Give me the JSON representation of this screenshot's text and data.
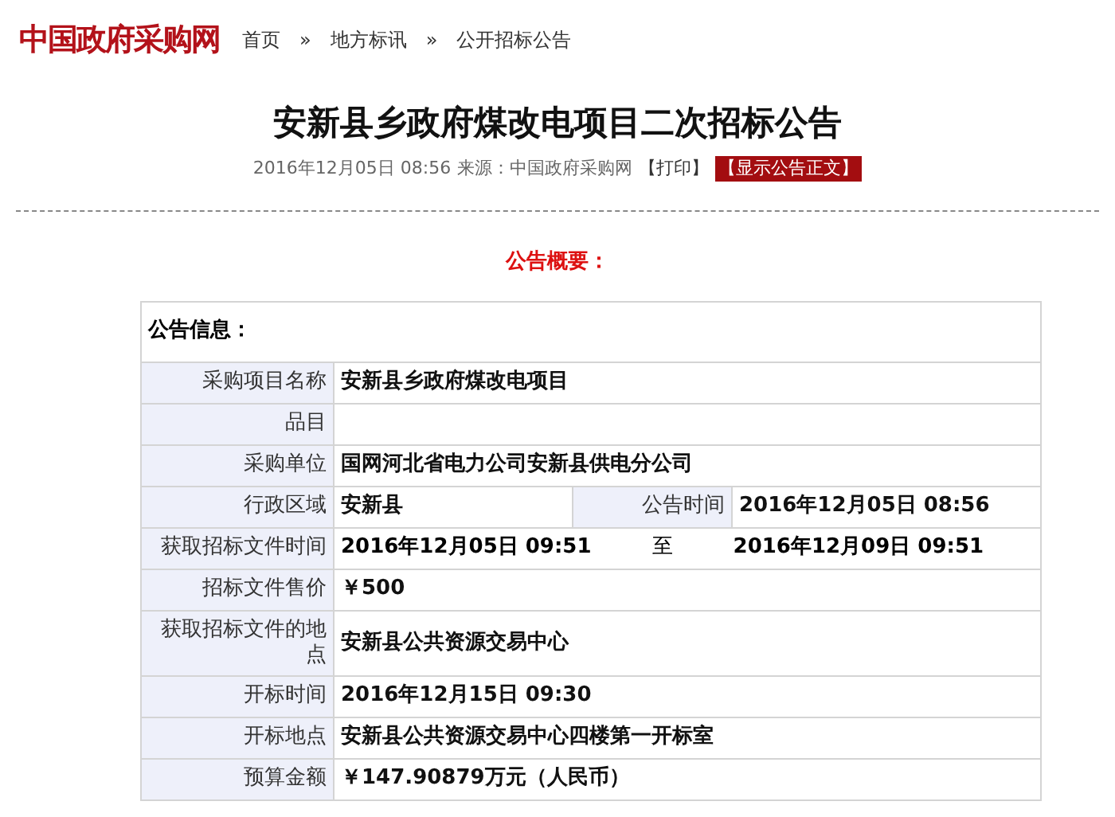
{
  "header": {
    "logo": "中国政府采购网",
    "breadcrumb": [
      "首页",
      "地方标讯",
      "公开招标公告"
    ],
    "separator": "»"
  },
  "article": {
    "title": "安新县乡政府煤改电项目二次招标公告",
    "date": "2016年12月05日 08:56",
    "source": "来源：中国政府采购网",
    "print_link": "【打印】",
    "show_text_link": "【显示公告正文】"
  },
  "summary": {
    "heading": "公告概要：",
    "table_heading": "公告信息：",
    "rows": [
      {
        "kind": "single",
        "label": "采购项目名称",
        "value": "安新县乡政府煤改电项目"
      },
      {
        "kind": "single",
        "label": "品目"
      },
      {
        "kind": "single",
        "label": "采购单位",
        "value": "国网河北省电力公司安新县供电分公司"
      },
      {
        "kind": "split",
        "label": "行政区域",
        "value": "安新县",
        "label2": "公告时间",
        "value2": "2016年12月05日 08:56"
      },
      {
        "kind": "range",
        "label": "获取招标文件时间",
        "value": "2016年12月05日 09:51",
        "separator": "至",
        "value2": "2016年12月09日 09:51"
      },
      {
        "kind": "single",
        "label": "招标文件售价",
        "value": "￥500"
      },
      {
        "kind": "tall",
        "label": "获取招标文件的地点",
        "value": "安新县公共资源交易中心"
      },
      {
        "kind": "single",
        "label": "开标时间",
        "value": "2016年12月15日 09:30"
      },
      {
        "kind": "single",
        "label": "开标地点",
        "value": "安新县公共资源交易中心四楼第一开标室"
      },
      {
        "kind": "single",
        "label": "预算金额",
        "value": "￥147.90879万元（人民币）"
      }
    ]
  }
}
